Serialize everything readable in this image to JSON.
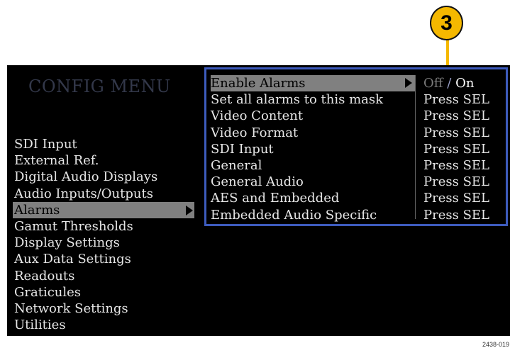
{
  "callout": {
    "number": "3"
  },
  "config_menu": {
    "title": "CONFIG MENU",
    "items": [
      {
        "label": "SDI Input"
      },
      {
        "label": "External Ref."
      },
      {
        "label": "Digital Audio Displays"
      },
      {
        "label": "Audio Inputs/Outputs"
      },
      {
        "label": "Alarms",
        "selected": true
      },
      {
        "label": "Gamut Thresholds"
      },
      {
        "label": "Display Settings"
      },
      {
        "label": "Aux Data Settings"
      },
      {
        "label": "Readouts"
      },
      {
        "label": "Graticules"
      },
      {
        "label": "Network Settings"
      },
      {
        "label": "Utilities"
      }
    ]
  },
  "alarms_submenu": {
    "rows": [
      {
        "label": "Enable Alarms",
        "value_off": "Off",
        "value_sep": "/",
        "value_on": "On",
        "selected": true
      },
      {
        "label": "Set all alarms to this mask",
        "value": "Press SEL"
      },
      {
        "label": "Video Content",
        "value": "Press SEL"
      },
      {
        "label": "Video Format",
        "value": "Press SEL"
      },
      {
        "label": "SDI Input",
        "value": "Press SEL"
      },
      {
        "label": "General",
        "value": "Press SEL"
      },
      {
        "label": "General Audio",
        "value": "Press SEL"
      },
      {
        "label": "AES and Embedded",
        "value": "Press SEL"
      },
      {
        "label": "Embedded Audio Specific",
        "value": "Press SEL"
      }
    ]
  },
  "figure_id": "2438-019",
  "colors": {
    "screen_bg": "#000000",
    "highlight": "#808080",
    "submenu_border": "#3d5bbd",
    "callout": "#f5b800",
    "title": "#33384a"
  }
}
